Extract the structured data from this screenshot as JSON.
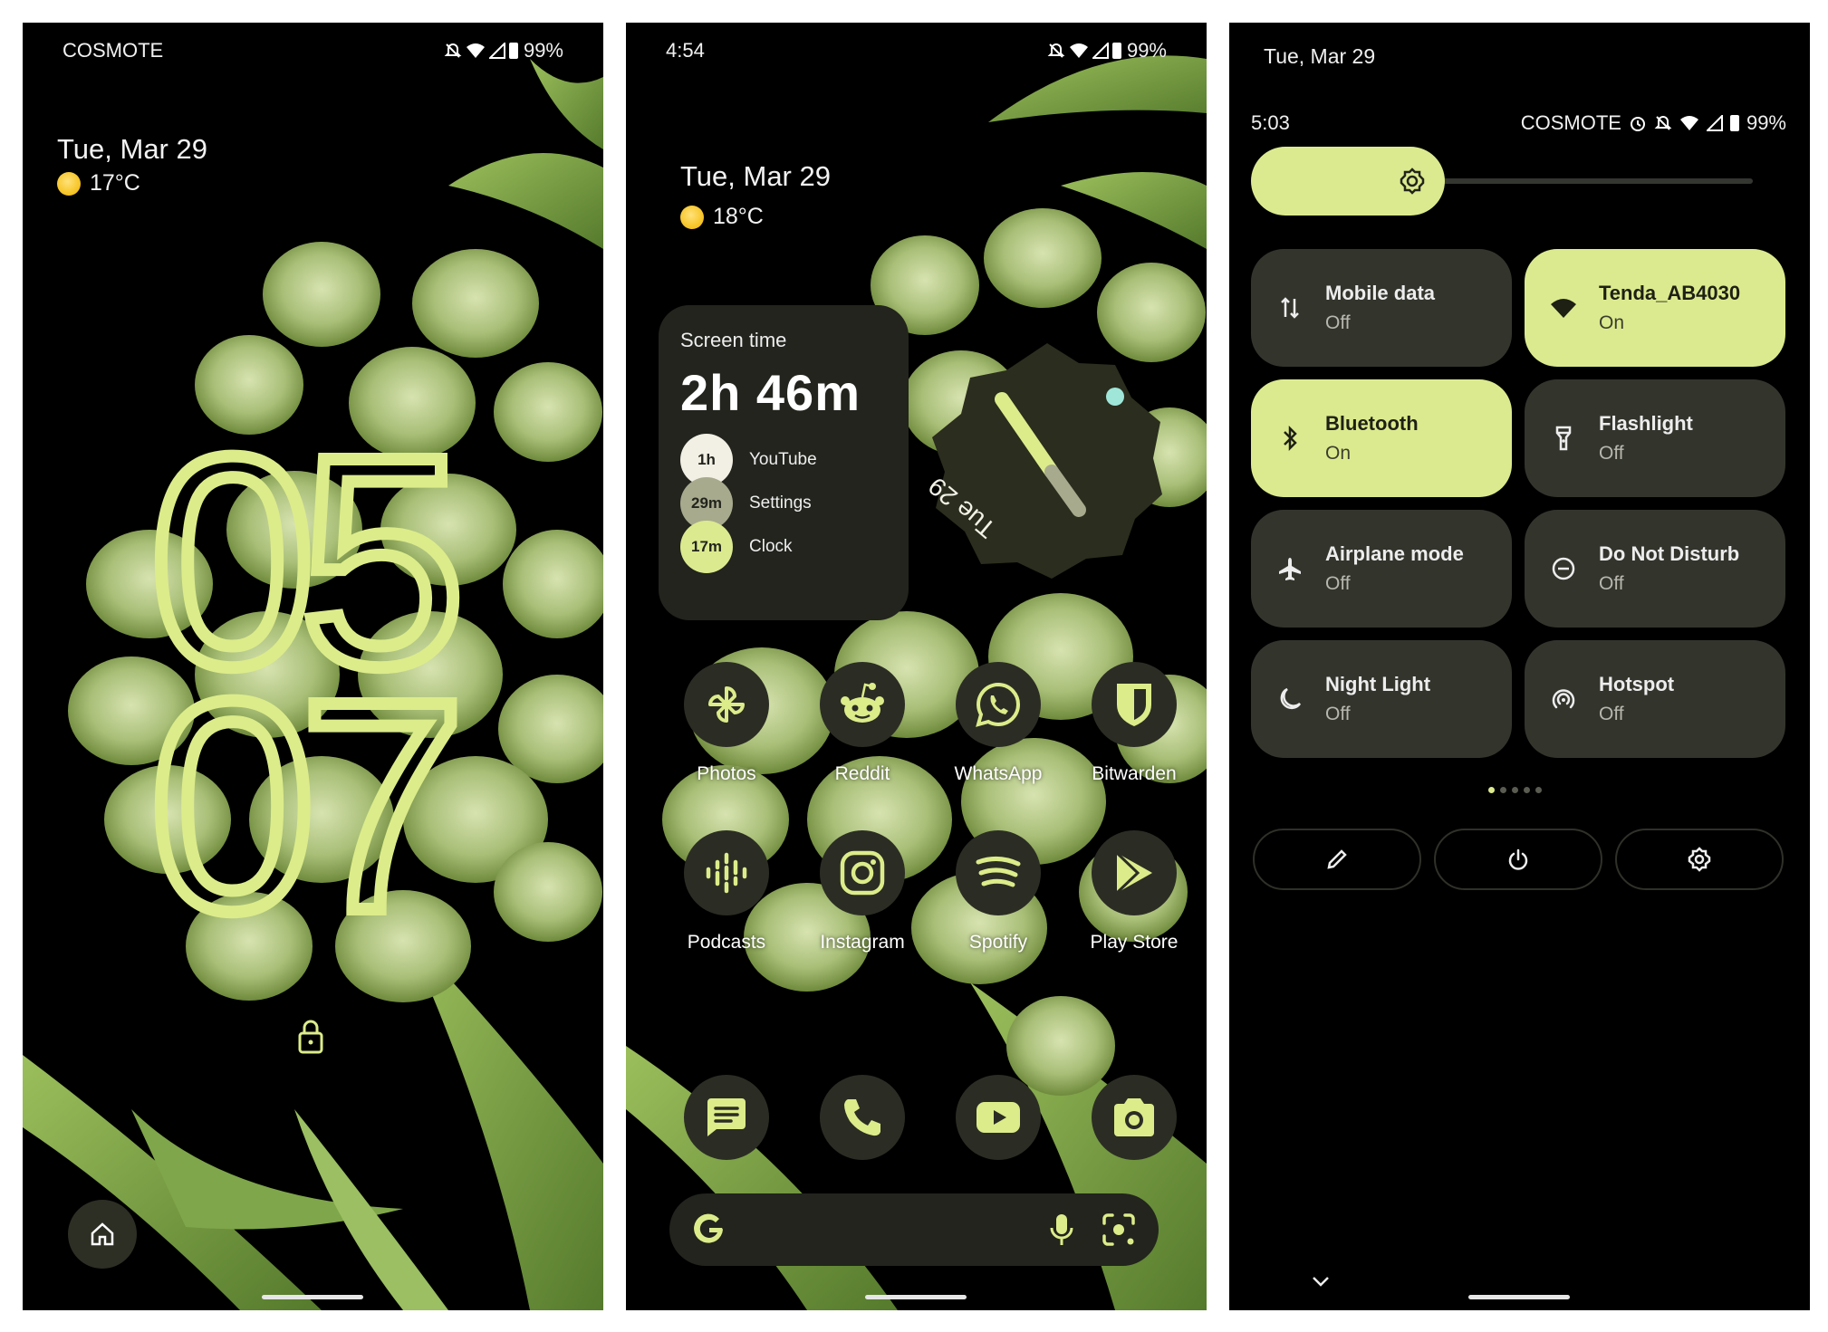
{
  "colors": {
    "accent": "#dcea8f",
    "tile_off": "#33352d",
    "widget_bg": "#22241d"
  },
  "lock_screen": {
    "carrier": "COSMOTE",
    "battery": "99%",
    "date": "Tue, Mar 29",
    "temperature": "17°C",
    "clock_hours": "05",
    "clock_minutes": "07",
    "icons": [
      "dnd-off-icon",
      "wifi-icon",
      "signal-icon",
      "battery-icon",
      "lock-icon",
      "home-icon"
    ]
  },
  "home_screen": {
    "time": "4:54",
    "battery": "99%",
    "date": "Tue, Mar 29",
    "temperature": "18°C",
    "screen_time": {
      "label": "Screen time",
      "total": "2h 46m",
      "apps": [
        {
          "badge": "1h",
          "name": "YouTube",
          "color": "#f2efe4"
        },
        {
          "badge": "29m",
          "name": "Settings",
          "color": "#a8aa8e"
        },
        {
          "badge": "17m",
          "name": "Clock",
          "color": "#dcea8f"
        }
      ]
    },
    "clock_widget_date": "Tue 29",
    "apps_row1": [
      "Photos",
      "Reddit",
      "WhatsApp",
      "Bitwarden"
    ],
    "apps_row2": [
      "Podcasts",
      "Instagram",
      "Spotify",
      "Play Store"
    ],
    "dock_icons": [
      "messages-icon",
      "phone-icon",
      "youtube-icon",
      "camera-icon"
    ],
    "search_icons": [
      "google-icon",
      "mic-icon",
      "lens-icon"
    ]
  },
  "quick_settings": {
    "date": "Tue, Mar 29",
    "time": "5:03",
    "carrier": "COSMOTE",
    "battery": "99%",
    "brightness": 0.35,
    "tiles": [
      {
        "label": "Mobile data",
        "state": "Off",
        "on": false,
        "icon": "mobile-data-icon"
      },
      {
        "label": "Tenda_AB4030",
        "state": "On",
        "on": true,
        "icon": "wifi-icon"
      },
      {
        "label": "Bluetooth",
        "state": "On",
        "on": true,
        "icon": "bluetooth-icon"
      },
      {
        "label": "Flashlight",
        "state": "Off",
        "on": false,
        "icon": "flashlight-icon"
      },
      {
        "label": "Airplane mode",
        "state": "Off",
        "on": false,
        "icon": "airplane-icon"
      },
      {
        "label": "Do Not Disturb",
        "state": "Off",
        "on": false,
        "icon": "dnd-icon"
      },
      {
        "label": "Night Light",
        "state": "Off",
        "on": false,
        "icon": "moon-icon"
      },
      {
        "label": "Hotspot",
        "state": "Off",
        "on": false,
        "icon": "hotspot-icon"
      }
    ],
    "pages": 5,
    "active_page": 1,
    "bottom_icons": [
      "edit-icon",
      "power-icon",
      "settings-icon"
    ]
  }
}
